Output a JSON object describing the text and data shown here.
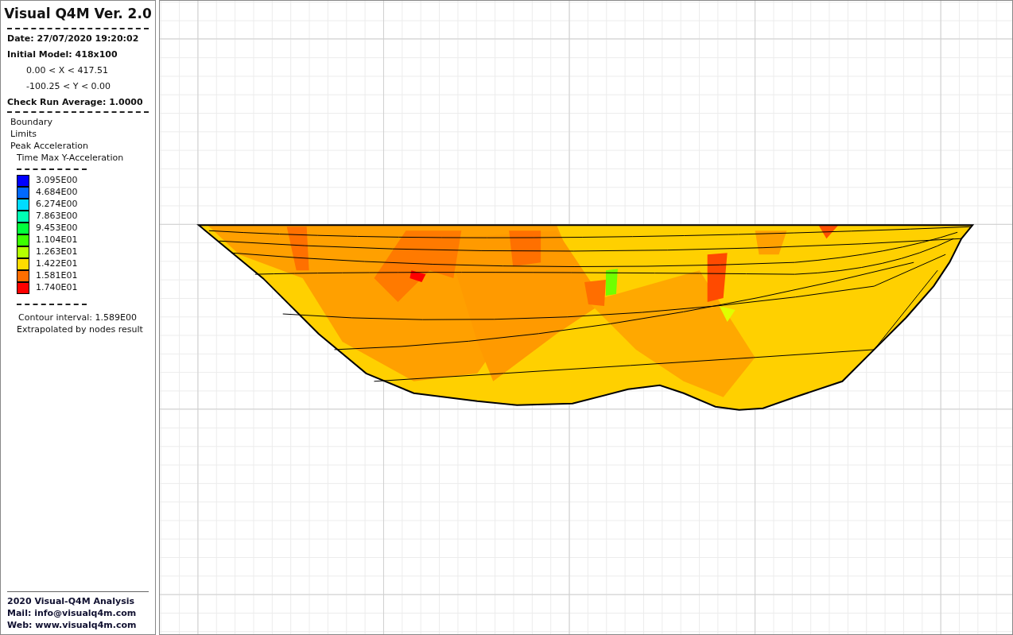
{
  "sidebar": {
    "title": "Visual Q4M Ver. 2.0",
    "date": "Date: 27/07/2020 19:20:02",
    "model": "Initial Model: 418x100",
    "x_range": "0.00 < X < 417.51",
    "y_range": "-100.25 < Y < 0.00",
    "check_run": "Check Run Average: 1.0000",
    "layers": [
      "Boundary",
      "Limits",
      "Peak Acceleration"
    ],
    "result": "Time Max Y-Acceleration",
    "legend": [
      {
        "label": "3.095E00",
        "color": "#0000ff"
      },
      {
        "label": "4.684E00",
        "color": "#0069ff"
      },
      {
        "label": "6.274E00",
        "color": "#00dcff"
      },
      {
        "label": "7.863E00",
        "color": "#00ffb4"
      },
      {
        "label": "9.453E00",
        "color": "#00ff3c"
      },
      {
        "label": "1.104E01",
        "color": "#3cff00"
      },
      {
        "label": "1.263E01",
        "color": "#b4ff00"
      },
      {
        "label": "1.422E01",
        "color": "#ffdc00"
      },
      {
        "label": "1.581E01",
        "color": "#ff6e00"
      },
      {
        "label": "1.740E01",
        "color": "#ff0000"
      }
    ],
    "contour_interval": "Contour interval: 1.589E00",
    "note": "Extrapolated by nodes result",
    "footer": [
      "2020 Visual-Q4M Analysis",
      "Mail: info@visualq4m.com",
      "Web: www.visualq4m.com"
    ]
  }
}
